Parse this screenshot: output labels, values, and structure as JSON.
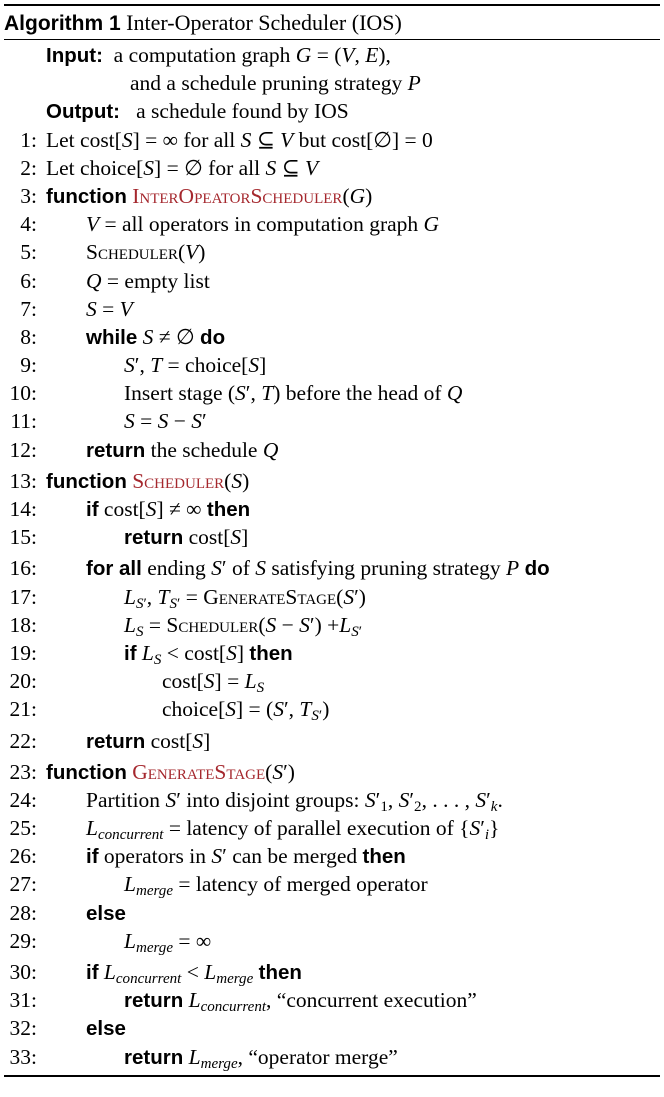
{
  "caption": {
    "label": "Algorithm 1",
    "title": "Inter-Operator Scheduler (IOS)"
  },
  "header": {
    "input_label": "Input:",
    "input_line1": "a computation graph G = (V, E),",
    "input_line2": "and a schedule pruning strategy P",
    "output_label": "Output:",
    "output_text": "a schedule found by IOS"
  },
  "lines": [
    {
      "n": "1:",
      "text": "Let cost[S] = ∞ for all S ⊆ V but cost[∅] = 0"
    },
    {
      "n": "2:",
      "text": "Let choice[S] = ∅ for all S ⊆ V"
    },
    {
      "n": "3:",
      "kw": "function",
      "fn": "InterOpeatorScheduler",
      "args": "(G)"
    },
    {
      "n": "4:",
      "text": "V = all operators in computation graph G"
    },
    {
      "n": "5:",
      "text": "Scheduler(V)"
    },
    {
      "n": "6:",
      "text": "Q = empty list"
    },
    {
      "n": "7:",
      "text": "S = V"
    },
    {
      "n": "8:",
      "kw": "while",
      "text": "S ≠ ∅",
      "kw2": "do"
    },
    {
      "n": "9:",
      "text": "S′, T = choice[S]"
    },
    {
      "n": "10:",
      "text": "Insert stage (S′, T) before the head of Q"
    },
    {
      "n": "11:",
      "text": "S = S − S′"
    },
    {
      "n": "12:",
      "kw": "return",
      "text": "the schedule Q"
    },
    {
      "n": "13:",
      "kw": "function",
      "fn": "Scheduler",
      "args": "(S)"
    },
    {
      "n": "14:",
      "kw": "if",
      "text": "cost[S] ≠ ∞",
      "kw2": "then"
    },
    {
      "n": "15:",
      "kw": "return",
      "text": "cost[S]"
    },
    {
      "n": "16:",
      "kw": "for all",
      "text": "ending S′ of S satisfying pruning strategy P",
      "kw2": "do"
    },
    {
      "n": "17:",
      "text": "LS′, TS′ = GenerateStage(S′)"
    },
    {
      "n": "18:",
      "text": "LS = Scheduler(S − S′) +LS′"
    },
    {
      "n": "19:",
      "kw": "if",
      "text": "LS < cost[S]",
      "kw2": "then"
    },
    {
      "n": "20:",
      "text": "cost[S] = LS"
    },
    {
      "n": "21:",
      "text": "choice[S] = (S′, TS′)"
    },
    {
      "n": "22:",
      "kw": "return",
      "text": "cost[S]"
    },
    {
      "n": "23:",
      "kw": "function",
      "fn": "GenerateStage",
      "args": "(S′)"
    },
    {
      "n": "24:",
      "text": "Partition S′ into disjoint groups: S′1, S′2, . . . , S′k."
    },
    {
      "n": "25:",
      "text": "Lconcurrent = latency of parallel execution of {S′i}"
    },
    {
      "n": "26:",
      "kw": "if",
      "text": "operators in S′ can be merged",
      "kw2": "then"
    },
    {
      "n": "27:",
      "text": "Lmerge = latency of merged operator"
    },
    {
      "n": "28:",
      "kw": "else"
    },
    {
      "n": "29:",
      "text": "Lmerge = ∞"
    },
    {
      "n": "30:",
      "kw": "if",
      "text": "Lconcurrent < Lmerge",
      "kw2": "then"
    },
    {
      "n": "31:",
      "kw": "return",
      "text": "Lconcurrent, “concurrent execution”"
    },
    {
      "n": "32:",
      "kw": "else"
    },
    {
      "n": "33:",
      "kw": "return",
      "text": "Lmerge, “operator merge”"
    }
  ]
}
